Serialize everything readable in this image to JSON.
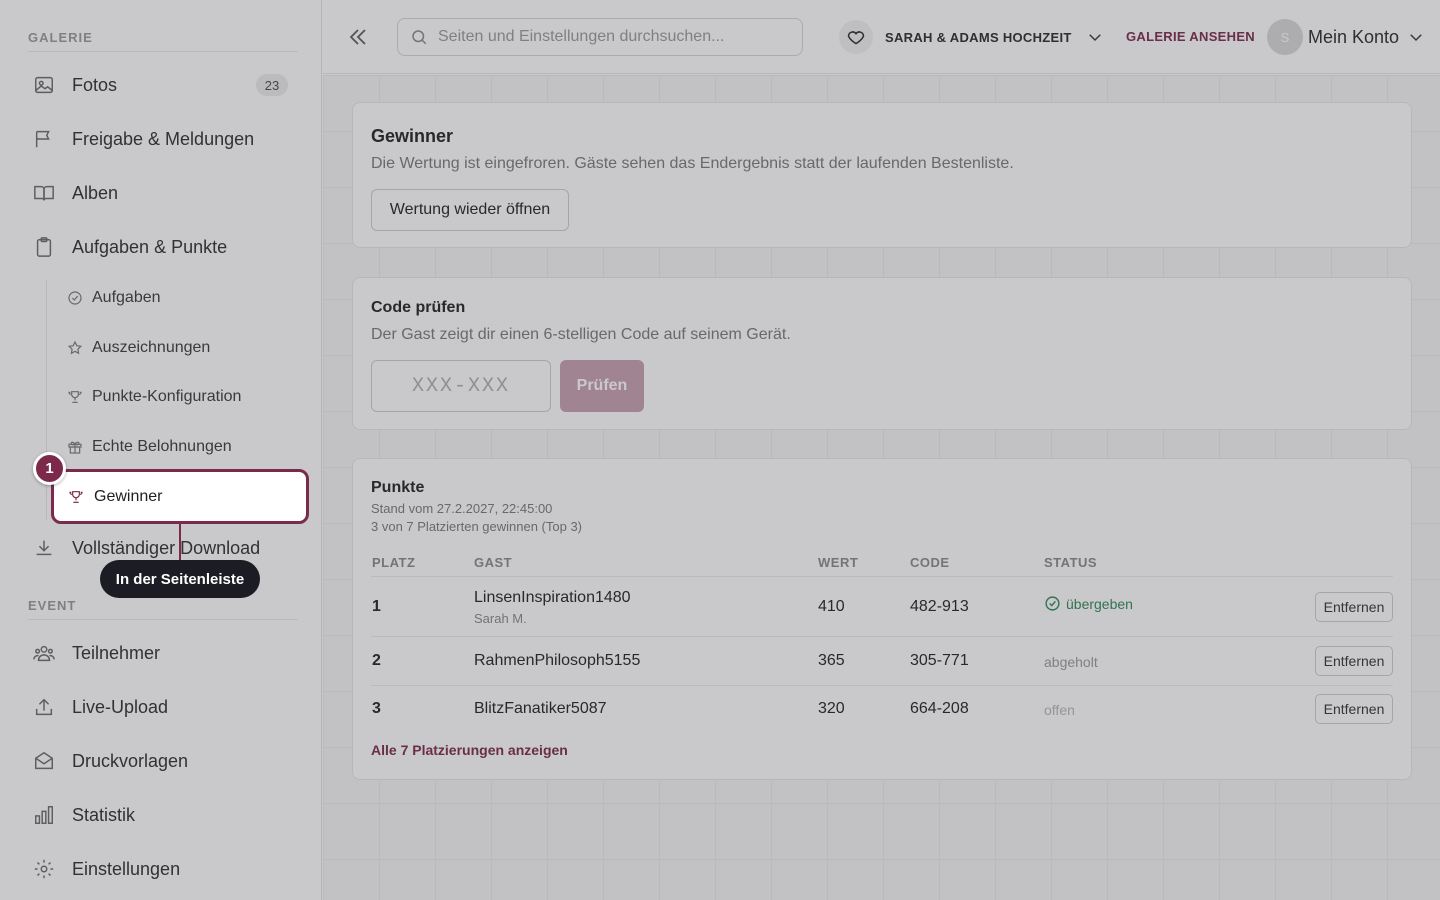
{
  "sidebar": {
    "section_gallery": "GALERIE",
    "section_event": "EVENT",
    "items": [
      {
        "label": "Fotos",
        "icon": "image-icon",
        "badge": "23"
      },
      {
        "label": "Freigabe & Meldungen",
        "icon": "flag-icon"
      },
      {
        "label": "Alben",
        "icon": "book-icon"
      },
      {
        "label": "Aufgaben & Punkte",
        "icon": "clipboard-icon"
      }
    ],
    "sub_items": [
      {
        "label": "Aufgaben",
        "icon": "check-circle-icon"
      },
      {
        "label": "Auszeichnungen",
        "icon": "star-icon"
      },
      {
        "label": "Punkte-Konfiguration",
        "icon": "trophy-icon"
      },
      {
        "label": "Echte Belohnungen",
        "icon": "gift-icon"
      },
      {
        "label": "Gewinner",
        "icon": "trophy-icon"
      }
    ],
    "download": {
      "label": "Vollständiger Download",
      "icon": "download-icon"
    },
    "event_items": [
      {
        "label": "Teilnehmer",
        "icon": "users-icon"
      },
      {
        "label": "Live-Upload",
        "icon": "upload-icon"
      },
      {
        "label": "Druckvorlagen",
        "icon": "envelope-icon"
      },
      {
        "label": "Statistik",
        "icon": "bar-chart-icon"
      },
      {
        "label": "Einstellungen",
        "icon": "gear-icon"
      }
    ]
  },
  "tutorial": {
    "step": "1",
    "tooltip": "In der Seitenleiste"
  },
  "header": {
    "search_placeholder": "Seiten und Einstellungen durchsuchen...",
    "gallery_name": "SARAH & ADAMS HOCHZEIT",
    "view_gallery": "GALERIE ANSEHEN",
    "avatar_initial": "S",
    "account_label": "Mein Konto"
  },
  "winners_card": {
    "title": "Gewinner",
    "description": "Die Wertung ist eingefroren. Gäste sehen das Endergebnis statt der laufenden Bestenliste.",
    "reopen_button": "Wertung wieder öffnen"
  },
  "code_card": {
    "title": "Code prüfen",
    "description": "Der Gast zeigt dir einen 6-stelligen Code auf seinem Gerät.",
    "input_placeholder": "XXX-XXX",
    "check_button": "Prüfen"
  },
  "points_card": {
    "title": "Punkte",
    "timestamp": "Stand vom 27.2.2027, 22:45:00",
    "summary": "3 von 7 Platzierten gewinnen (Top 3)",
    "columns": {
      "rank": "PLATZ",
      "guest": "GAST",
      "value": "WERT",
      "code": "CODE",
      "status": "STATUS"
    },
    "rows": [
      {
        "rank": "1",
        "guest": "LinsenInspiration1480",
        "guest_sub": "Sarah M.",
        "value": "410",
        "code": "482-913",
        "status": "übergeben",
        "action": "Entfernen"
      },
      {
        "rank": "2",
        "guest": "RahmenPhilosoph5155",
        "guest_sub": "",
        "value": "365",
        "code": "305-771",
        "status": "abgeholt",
        "action": "Entfernen"
      },
      {
        "rank": "3",
        "guest": "BlitzFanatiker5087",
        "guest_sub": "",
        "value": "320",
        "code": "664-208",
        "status": "offen",
        "action": "Entfernen"
      }
    ],
    "show_all": "Alle 7 Platzierungen anzeigen"
  },
  "colors": {
    "accent": "#7b2a4c",
    "success": "#2e8b57"
  }
}
